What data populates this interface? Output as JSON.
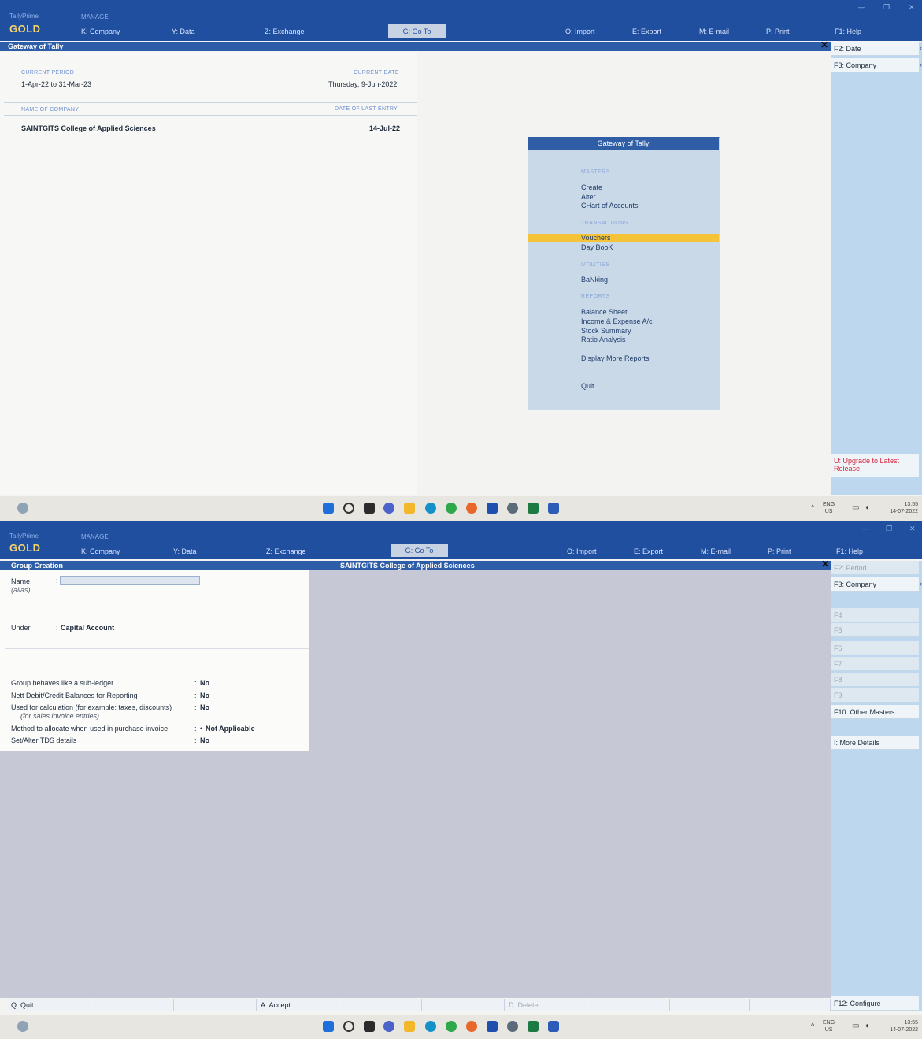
{
  "screen1": {
    "topbar": {
      "brand_line1": "TallyPrime",
      "edition": "GOLD",
      "manage": "MANAGE",
      "menu": [
        {
          "key": "K",
          "label": "K: Company"
        },
        {
          "key": "Y",
          "label": "Y: Data"
        },
        {
          "key": "Z",
          "label": "Z: Exchange"
        },
        {
          "key": "G",
          "label": "G: Go To"
        },
        {
          "key": "O",
          "label": "O: Import"
        },
        {
          "key": "E",
          "label": "E: Export"
        },
        {
          "key": "M",
          "label": "M: E-mail"
        },
        {
          "key": "P",
          "label": "P: Print"
        },
        {
          "key": "F1",
          "label": "F1: Help"
        }
      ]
    },
    "title": "Gateway of Tally",
    "current_period_label": "CURRENT PERIOD",
    "current_period": "1-Apr-22 to 31-Mar-23",
    "current_date_label": "CURRENT DATE",
    "current_date": "Thursday, 9-Jun-2022",
    "name_of_company_label": "NAME OF COMPANY",
    "date_last_entry_label": "DATE OF LAST ENTRY",
    "company_name": "SAINTGITS College of Applied Sciences",
    "last_entry_date": "14-Jul-22",
    "gateway_menu": {
      "title": "Gateway of Tally",
      "sections": {
        "masters": "MASTERS",
        "transactions": "TRANSACTIONS",
        "utilities": "UTILITIES",
        "reports": "REPORTS"
      },
      "items": {
        "create": "Create",
        "alter": "Alter",
        "chart": "CHart of Accounts",
        "vouchers": "Vouchers",
        "daybook": "Day BooK",
        "banking": "BaNking",
        "balance_sheet": "Balance Sheet",
        "income_expense": "Income & Expense A/c",
        "stock_summary": "Stock Summary",
        "ratio": "Ratio Analysis",
        "display_more": "Display More Reports",
        "quit": "Quit"
      }
    },
    "right_buttons": {
      "f2": "F2: Date",
      "f3": "F3: Company",
      "upgrade": "U: Upgrade to Latest Release"
    },
    "taskbar": {
      "lang1": "ENG",
      "lang2": "US",
      "time": "13:55",
      "date": "14-07-2022"
    }
  },
  "screen2": {
    "topbar": {
      "brand_line1": "TallyPrime",
      "edition": "GOLD",
      "manage": "MANAGE",
      "menu": [
        {
          "label": "K: Company"
        },
        {
          "label": "Y: Data"
        },
        {
          "label": "Z: Exchange"
        },
        {
          "label": "G: Go To"
        },
        {
          "label": "O: Import"
        },
        {
          "label": "E: Export"
        },
        {
          "label": "M: E-mail"
        },
        {
          "label": "P: Print"
        },
        {
          "label": "F1: Help"
        }
      ]
    },
    "title": "Group Creation",
    "company": "SAINTGITS College of Applied Sciences",
    "form": {
      "name_label": "Name",
      "alias_label": "(alias)",
      "under_label": "Under",
      "under_value": "Capital Account",
      "q1": "Group behaves like a sub-ledger",
      "a1": "No",
      "q2": "Nett Debit/Credit Balances for Reporting",
      "a2": "No",
      "q3": "Used for calculation (for example: taxes, discounts)",
      "q3b": "(for sales invoice entries)",
      "a3": "No",
      "q4": "Method to allocate when used in purchase invoice",
      "a4": "Not Applicable",
      "q5": "Set/Alter TDS details",
      "a5": "No"
    },
    "right_buttons": {
      "f2": "F2: Period",
      "f3": "F3: Company",
      "f4": "F4",
      "f5": "F5",
      "f6": "F6",
      "f7": "F7",
      "f8": "F8",
      "f9": "F9",
      "f10": "F10: Other Masters",
      "more": "I: More Details",
      "f12": "F12: Configure"
    },
    "bottom_buttons": {
      "quit": "Q: Quit",
      "accept": "A: Accept",
      "delete": "D: Delete"
    },
    "taskbar": {
      "lang1": "ENG",
      "lang2": "US",
      "time": "13:55",
      "date": "14-07-2022"
    }
  }
}
